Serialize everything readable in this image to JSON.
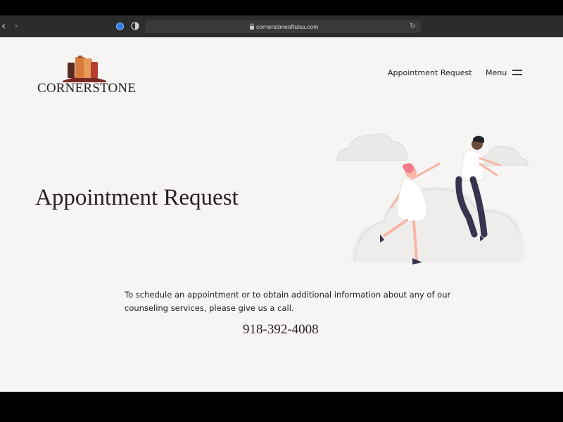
{
  "browser": {
    "url": "cornerstoneoftulsa.com",
    "back_glyph": "‹",
    "forward_glyph": "›",
    "reload_glyph": "↻",
    "icons": [
      "extension-icon",
      "shield-icon",
      "lock-icon",
      "reload-icon"
    ]
  },
  "header": {
    "logo_text": "CORNERSTONE",
    "nav_link": "Appointment Request",
    "menu_label": "Menu"
  },
  "hero": {
    "title": "Appointment Request",
    "illustration": "couple-floating-in-clouds"
  },
  "content": {
    "intro": "To schedule an appointment or to obtain additional information about any of our counseling services, please give us a call.",
    "phone": "918-392-4008"
  },
  "colors": {
    "page_bg": "#f6f5f3",
    "text_dark": "#2b1f22",
    "logo_orange": "#d97a3a",
    "logo_brown": "#7a2a22",
    "accent_pink": "#f47a8a",
    "navy": "#3a3350"
  }
}
